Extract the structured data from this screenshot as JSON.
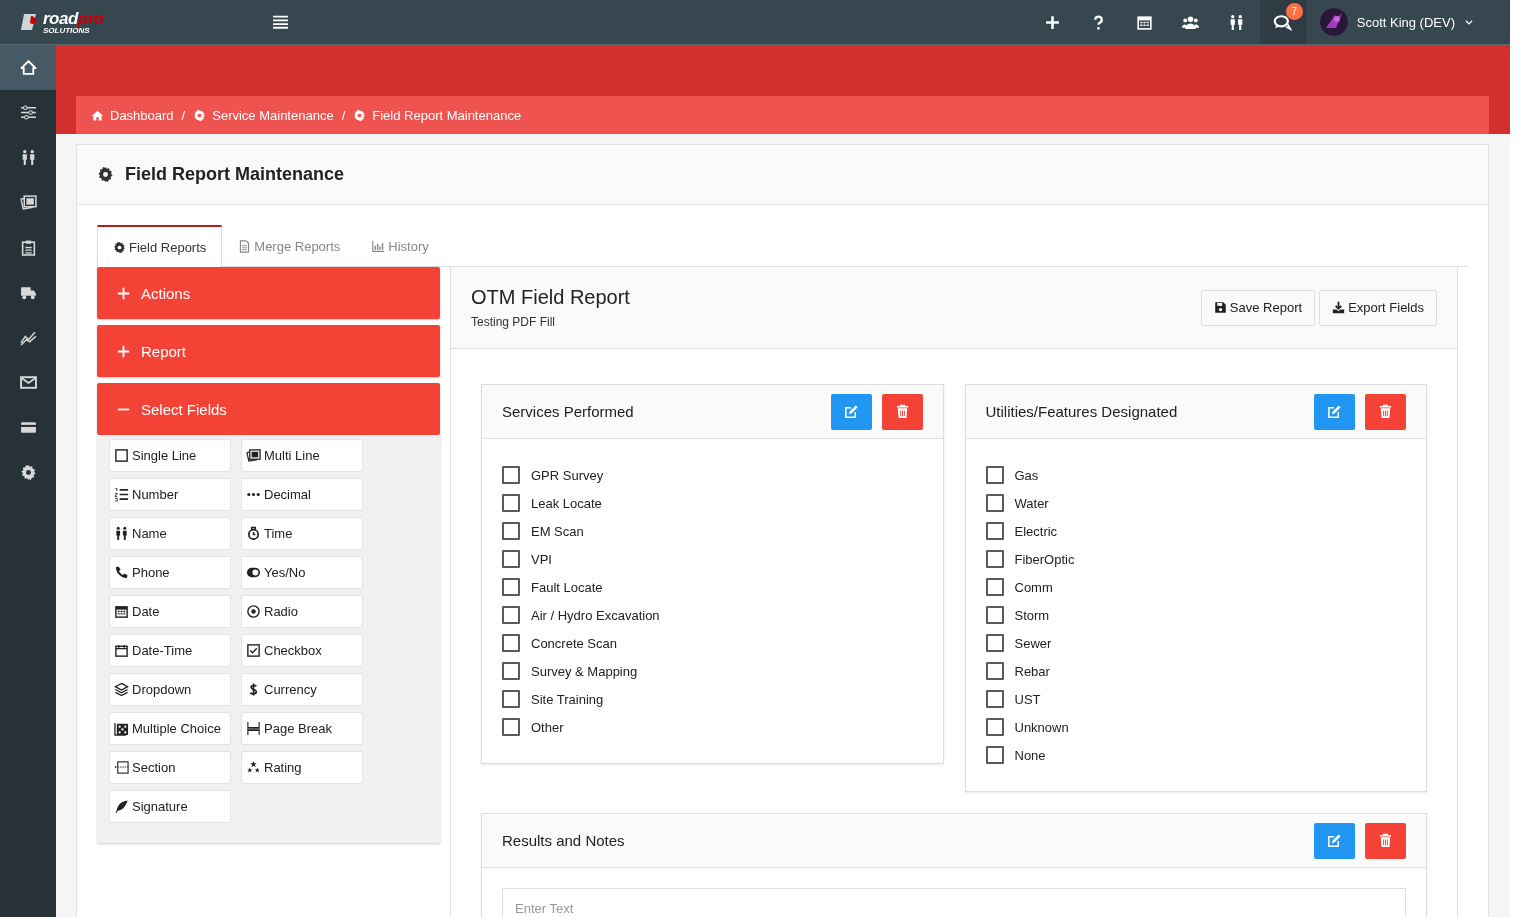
{
  "topbar": {
    "logo": {
      "word_1": "road",
      "word_2": "pro",
      "tagline": "SOLUTIONS"
    },
    "actions": [
      {
        "kind": "plus",
        "selected": false
      },
      {
        "kind": "help",
        "selected": false
      },
      {
        "kind": "calendar",
        "selected": false
      },
      {
        "kind": "group",
        "selected": false
      },
      {
        "kind": "people",
        "selected": false
      },
      {
        "kind": "chat",
        "selected": true,
        "badge": "7"
      }
    ],
    "user": {
      "name": "Scott King (DEV)"
    }
  },
  "sidebar": {
    "items": [
      {
        "kind": "home",
        "selected": true
      },
      {
        "kind": "sliders",
        "selected": false
      },
      {
        "kind": "people",
        "selected": false
      },
      {
        "kind": "photos",
        "selected": false
      },
      {
        "kind": "clipboard",
        "selected": false
      },
      {
        "kind": "truck",
        "selected": false
      },
      {
        "kind": "chart",
        "selected": false
      },
      {
        "kind": "mail",
        "selected": false
      },
      {
        "kind": "card",
        "selected": false
      },
      {
        "kind": "gear",
        "selected": false
      }
    ]
  },
  "breadcrumb": [
    {
      "label": "Dashboard",
      "kind": "home"
    },
    {
      "label": "Service Maintenance",
      "kind": "gear",
      "separator": "/"
    },
    {
      "label": "Field Report Maintenance",
      "kind": "gear",
      "separator": "/"
    }
  ],
  "page": {
    "title": "Field Report Maintenance"
  },
  "tabs": [
    {
      "label": "Field Reports",
      "kind": "gear",
      "selected": true
    },
    {
      "label": "Merge Reports",
      "kind": "file",
      "selected": false
    },
    {
      "label": "History",
      "kind": "chart",
      "selected": false
    }
  ],
  "accordion": [
    {
      "label": "Actions",
      "expanded": false
    },
    {
      "label": "Report",
      "expanded": false
    },
    {
      "label": "Select Fields",
      "expanded": true
    }
  ],
  "field_types": [
    {
      "label": "Single Line",
      "kind": "square"
    },
    {
      "label": "Multi Line",
      "kind": "photos"
    },
    {
      "label": "Number",
      "kind": "list"
    },
    {
      "label": "Decimal",
      "kind": "dots"
    },
    {
      "label": "Name",
      "kind": "people"
    },
    {
      "label": "Time",
      "kind": "clock"
    },
    {
      "label": "Phone",
      "kind": "phone"
    },
    {
      "label": "Yes/No",
      "kind": "toggle"
    },
    {
      "label": "Date",
      "kind": "calendar"
    },
    {
      "label": "Radio",
      "kind": "radio"
    },
    {
      "label": "Date-Time",
      "kind": "calendar-empty"
    },
    {
      "label": "Checkbox",
      "kind": "checkbox"
    },
    {
      "label": "Dropdown",
      "kind": "layers"
    },
    {
      "label": "Currency",
      "kind": "dollar"
    },
    {
      "label": "Multiple Choice",
      "kind": "dice"
    },
    {
      "label": "Page Break",
      "kind": "pagebreak"
    },
    {
      "label": "Section",
      "kind": "section"
    },
    {
      "label": "Rating",
      "kind": "stars"
    },
    {
      "label": "Signature",
      "kind": "feather"
    }
  ],
  "report": {
    "title": "OTM Field Report",
    "subtitle": "Testing PDF Fill",
    "buttons": [
      {
        "label": "Save Report",
        "kind": "save"
      },
      {
        "label": "Export Fields",
        "kind": "download"
      }
    ],
    "sections": [
      {
        "title": "Services Performed",
        "kind": "checklist",
        "options": [
          {
            "label": "GPR Survey",
            "checked": false
          },
          {
            "label": "Leak Locate",
            "checked": false
          },
          {
            "label": "EM Scan",
            "checked": false
          },
          {
            "label": "VPI",
            "checked": false
          },
          {
            "label": "Fault Locate",
            "checked": false
          },
          {
            "label": "Air / Hydro Excavation",
            "checked": false
          },
          {
            "label": "Concrete Scan",
            "checked": false
          },
          {
            "label": "Survey & Mapping",
            "checked": false
          },
          {
            "label": "Site Training",
            "checked": false
          },
          {
            "label": "Other",
            "checked": false
          }
        ]
      },
      {
        "title": "Utilities/Features Designated",
        "kind": "checklist",
        "options": [
          {
            "label": "Gas",
            "checked": false
          },
          {
            "label": "Water",
            "checked": false
          },
          {
            "label": "Electric",
            "checked": false
          },
          {
            "label": "FiberOptic",
            "checked": false
          },
          {
            "label": "Comm",
            "checked": false
          },
          {
            "label": "Storm",
            "checked": false
          },
          {
            "label": "Sewer",
            "checked": false
          },
          {
            "label": "Rebar",
            "checked": false
          },
          {
            "label": "UST",
            "checked": false
          },
          {
            "label": "Unknown",
            "checked": false
          },
          {
            "label": "None",
            "checked": false
          }
        ]
      },
      {
        "title": "Results and Notes",
        "kind": "text",
        "placeholder": "Enter Text"
      }
    ]
  }
}
